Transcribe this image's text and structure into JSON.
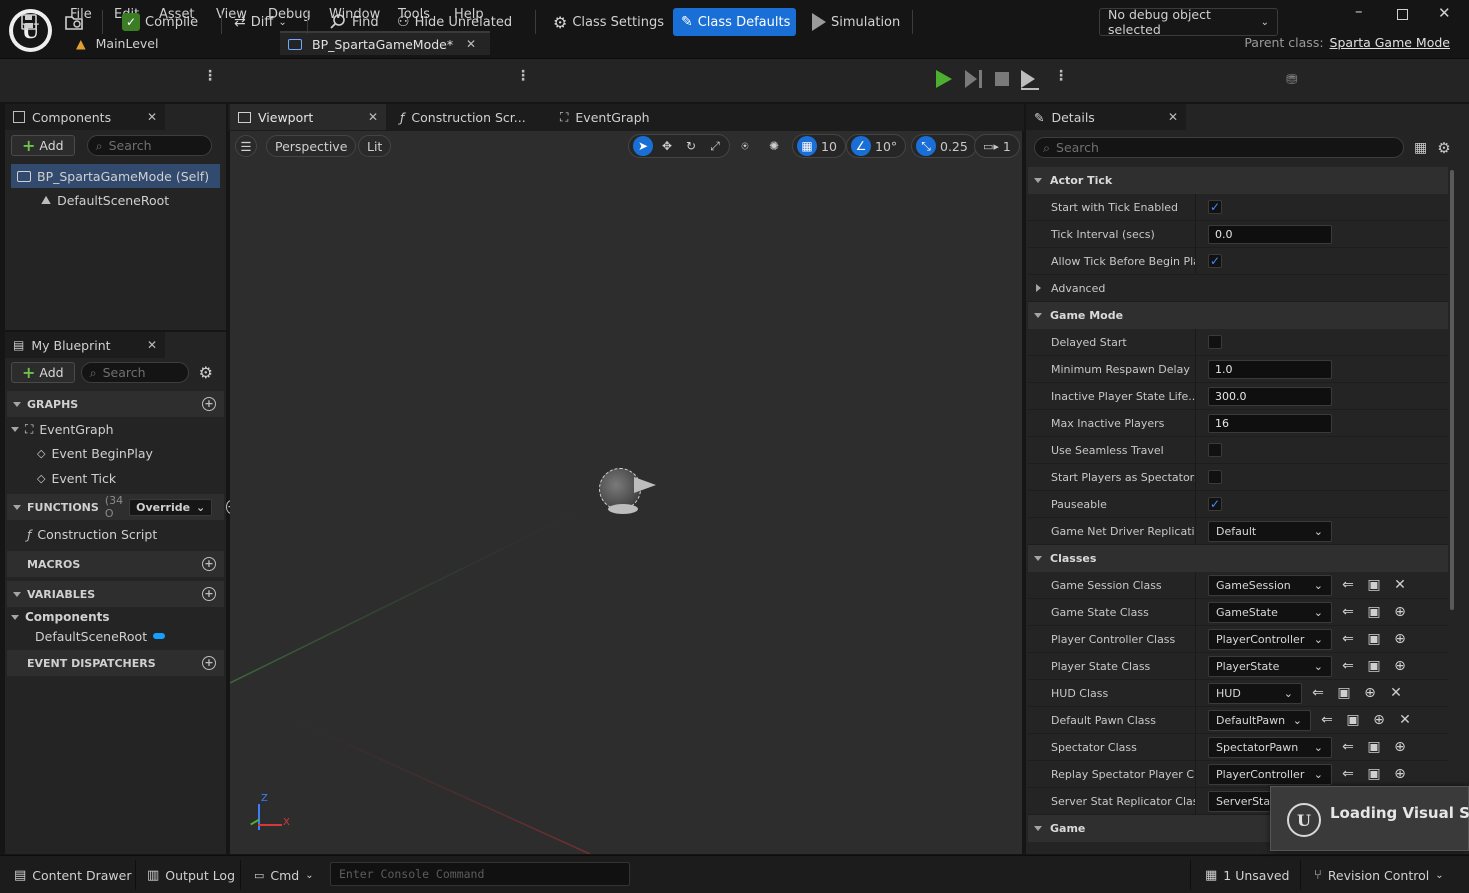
{
  "menu": [
    "File",
    "Edit",
    "Asset",
    "View",
    "Debug",
    "Window",
    "Tools",
    "Help"
  ],
  "tabs": {
    "level": "MainLevel",
    "blueprint": "BP_SpartaGameMode*"
  },
  "parent_class": {
    "label": "Parent class:",
    "value": "Sparta Game Mode"
  },
  "toolbar": {
    "compile": "Compile",
    "diff": "Diff",
    "find": "Find",
    "hide_unrelated": "Hide Unrelated",
    "class_settings": "Class Settings",
    "class_defaults": "Class Defaults",
    "simulation": "Simulation",
    "debug_object": "No debug object selected"
  },
  "components_panel": {
    "tab": "Components",
    "add": "Add",
    "search_placeholder": "Search",
    "self_item": "BP_SpartaGameMode (Self)",
    "root_item": "DefaultSceneRoot"
  },
  "my_blueprint": {
    "tab": "My Blueprint",
    "add": "Add",
    "search_placeholder": "Search",
    "graphs_header": "GRAPHS",
    "event_graph": "EventGraph",
    "event_begin_play": "Event BeginPlay",
    "event_tick": "Event Tick",
    "functions_header": "FUNCTIONS",
    "functions_count": "(34 O",
    "override": "Override",
    "construction_script": "Construction Script",
    "macros_header": "MACROS",
    "variables_header": "VARIABLES",
    "components_group": "Components",
    "default_scene_root": "DefaultSceneRoot",
    "event_dispatchers_header": "EVENT DISPATCHERS"
  },
  "editor_tabs": {
    "viewport": "Viewport",
    "construction": "Construction Scr...",
    "event_graph": "EventGraph"
  },
  "viewport": {
    "perspective": "Perspective",
    "lit": "Lit",
    "grid_snap": "10",
    "rotation_snap": "10°",
    "scale_snap": "0.25",
    "camera_speed": "1",
    "axis_x": "X",
    "axis_z": "Z"
  },
  "details": {
    "tab": "Details",
    "search_placeholder": "Search",
    "actor_tick": {
      "header": "Actor Tick",
      "start_with_tick": "Start with Tick Enabled",
      "start_with_tick_checked": true,
      "tick_interval": "Tick Interval (secs)",
      "tick_interval_value": "0.0",
      "allow_tick_before_begin_play": "Allow Tick Before Begin Play",
      "allow_tick_checked": true,
      "advanced": "Advanced"
    },
    "game_mode": {
      "header": "Game Mode",
      "delayed_start": "Delayed Start",
      "min_respawn_delay": "Minimum Respawn Delay",
      "min_respawn_delay_value": "1.0",
      "inactive_player_state": "Inactive Player State Life...",
      "inactive_player_state_value": "300.0",
      "max_inactive_players": "Max Inactive Players",
      "max_inactive_players_value": "16",
      "use_seamless_travel": "Use Seamless Travel",
      "start_players_as_spectators": "Start Players as Spectators",
      "pauseable": "Pauseable",
      "pauseable_checked": true,
      "net_driver_replication": "Game Net Driver Replicatio...",
      "net_driver_replication_value": "Default"
    },
    "classes": {
      "header": "Classes",
      "game_session": "Game Session Class",
      "game_session_value": "GameSession",
      "game_state": "Game State Class",
      "game_state_value": "GameState",
      "player_controller": "Player Controller Class",
      "player_controller_value": "PlayerController",
      "player_state": "Player State Class",
      "player_state_value": "PlayerState",
      "hud": "HUD Class",
      "hud_value": "HUD",
      "default_pawn": "Default Pawn Class",
      "default_pawn_value": "DefaultPawn",
      "spectator": "Spectator Class",
      "spectator_value": "SpectatorPawn",
      "replay_spectator": "Replay Spectator Player C...",
      "replay_spectator_value": "PlayerController",
      "server_stat": "Server Stat Replicator Class",
      "server_stat_value": "ServerStat"
    },
    "game_header": "Game"
  },
  "status_bar": {
    "content_drawer": "Content Drawer",
    "output_log": "Output Log",
    "cmd": "Cmd",
    "console_placeholder": "Enter Console Command",
    "unsaved": "1 Unsaved",
    "revision_control": "Revision Control"
  },
  "toast": {
    "text": "Loading Visual Stu"
  },
  "colors": {
    "accent": "#1a6fd6",
    "play_green": "#4caf2f",
    "checkbox_blue": "#3c8dff"
  }
}
